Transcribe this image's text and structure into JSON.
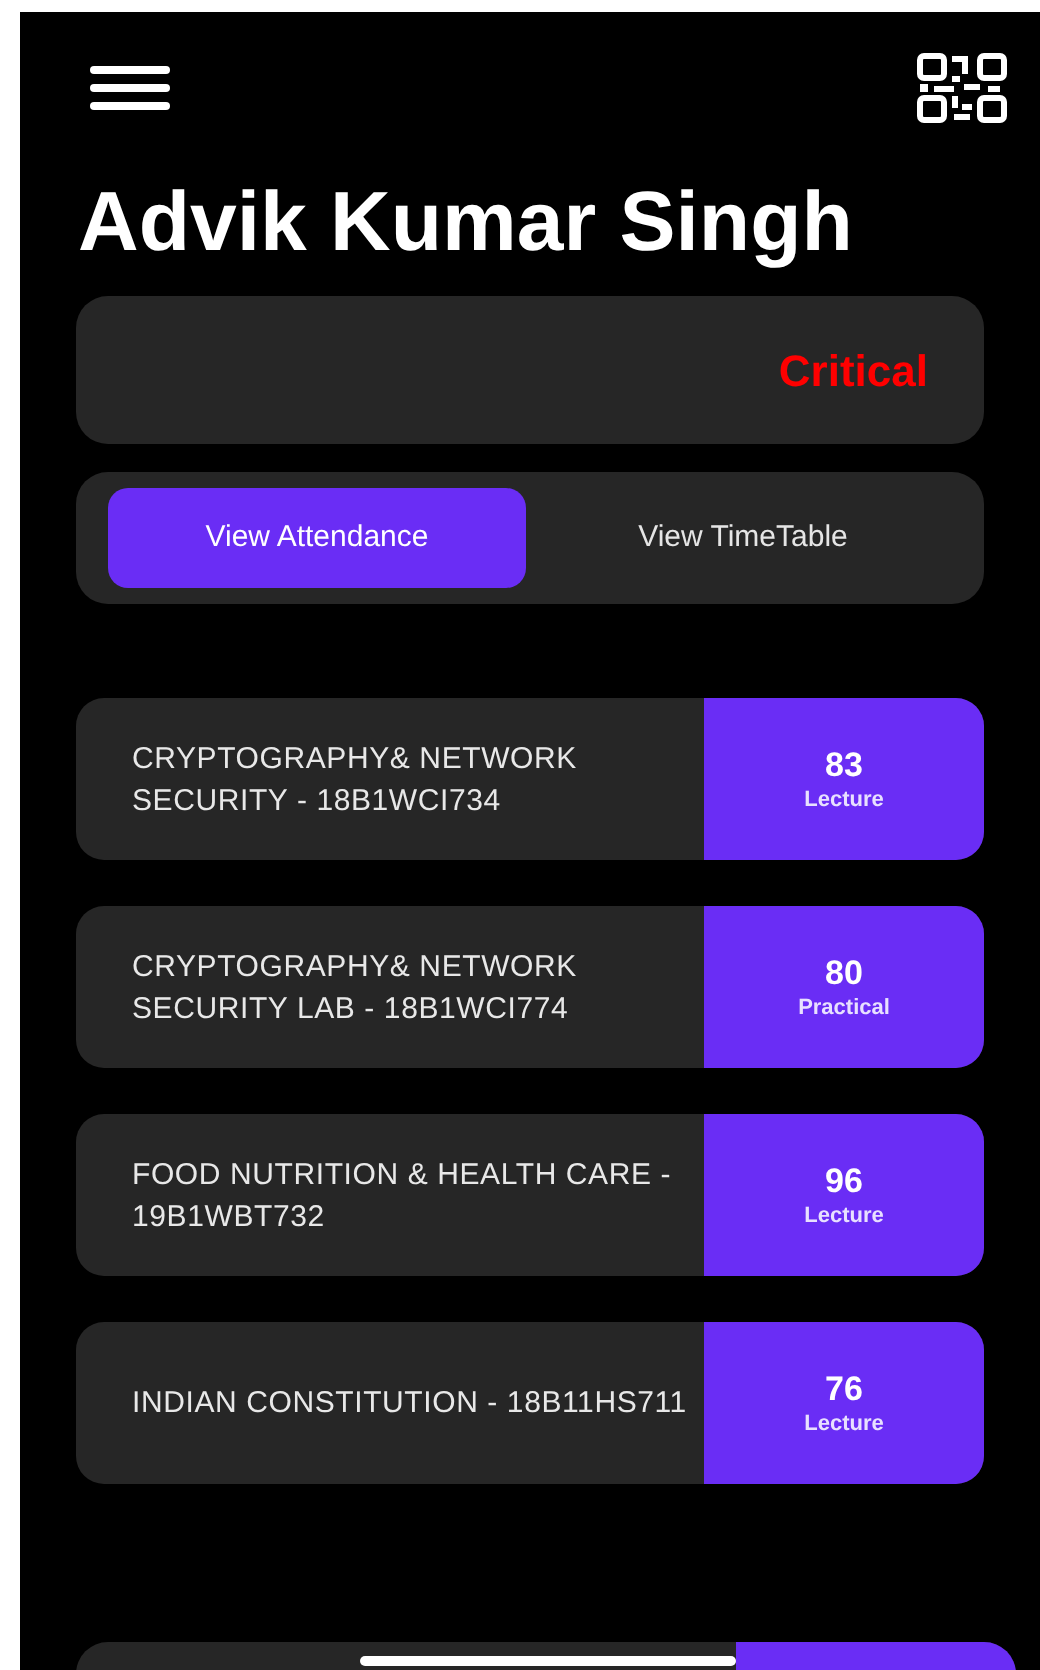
{
  "header": {
    "title": "Advik Kumar Singh"
  },
  "status": {
    "label": "Critical"
  },
  "tabs": [
    {
      "label": "View Attendance",
      "selected": true
    },
    {
      "label": "View TimeTable",
      "selected": false
    }
  ],
  "courses": [
    {
      "name": "CRYPTOGRAPHY& NETWORK SECURITY - 18B1WCI734",
      "percent": "83",
      "type": "Lecture"
    },
    {
      "name": "CRYPTOGRAPHY& NETWORK SECURITY LAB - 18B1WCI774",
      "percent": "80",
      "type": "Practical"
    },
    {
      "name": "FOOD NUTRITION & HEALTH CARE - 19B1WBT732",
      "percent": "96",
      "type": "Lecture"
    },
    {
      "name": "INDIAN CONSTITUTION - 18B11HS711",
      "percent": "76",
      "type": "Lecture"
    }
  ]
}
